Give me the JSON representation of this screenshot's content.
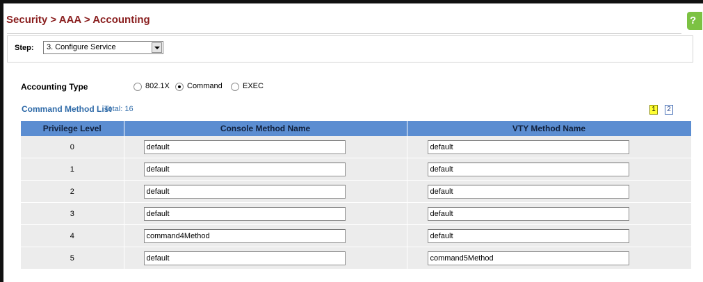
{
  "header": {
    "breadcrumb": "Security > AAA > Accounting",
    "help_icon": "?"
  },
  "step": {
    "label": "Step:",
    "value": "3. Configure Service"
  },
  "accounting_type": {
    "label": "Accounting Type",
    "options": [
      {
        "label": "802.1X",
        "checked": false
      },
      {
        "label": "Command",
        "checked": true
      },
      {
        "label": "EXEC",
        "checked": false
      }
    ]
  },
  "list": {
    "title": "Command Method List",
    "total": "Total: 16",
    "pages": [
      "1",
      "2"
    ],
    "active_page": "1"
  },
  "table": {
    "columns": [
      "Privilege Level",
      "Console Method Name",
      "VTY Method Name"
    ],
    "rows": [
      {
        "level": "0",
        "console": "default",
        "vty": "default"
      },
      {
        "level": "1",
        "console": "default",
        "vty": "default"
      },
      {
        "level": "2",
        "console": "default",
        "vty": "default"
      },
      {
        "level": "3",
        "console": "default",
        "vty": "default"
      },
      {
        "level": "4",
        "console": "command4Method",
        "vty": "default"
      },
      {
        "level": "5",
        "console": "default",
        "vty": "command5Method"
      }
    ]
  },
  "colors": {
    "breadcrumb": "#8a1f1f",
    "header_bg": "#5b8dd1",
    "row_bg": "#ececec",
    "link": "#2e6aa8"
  }
}
